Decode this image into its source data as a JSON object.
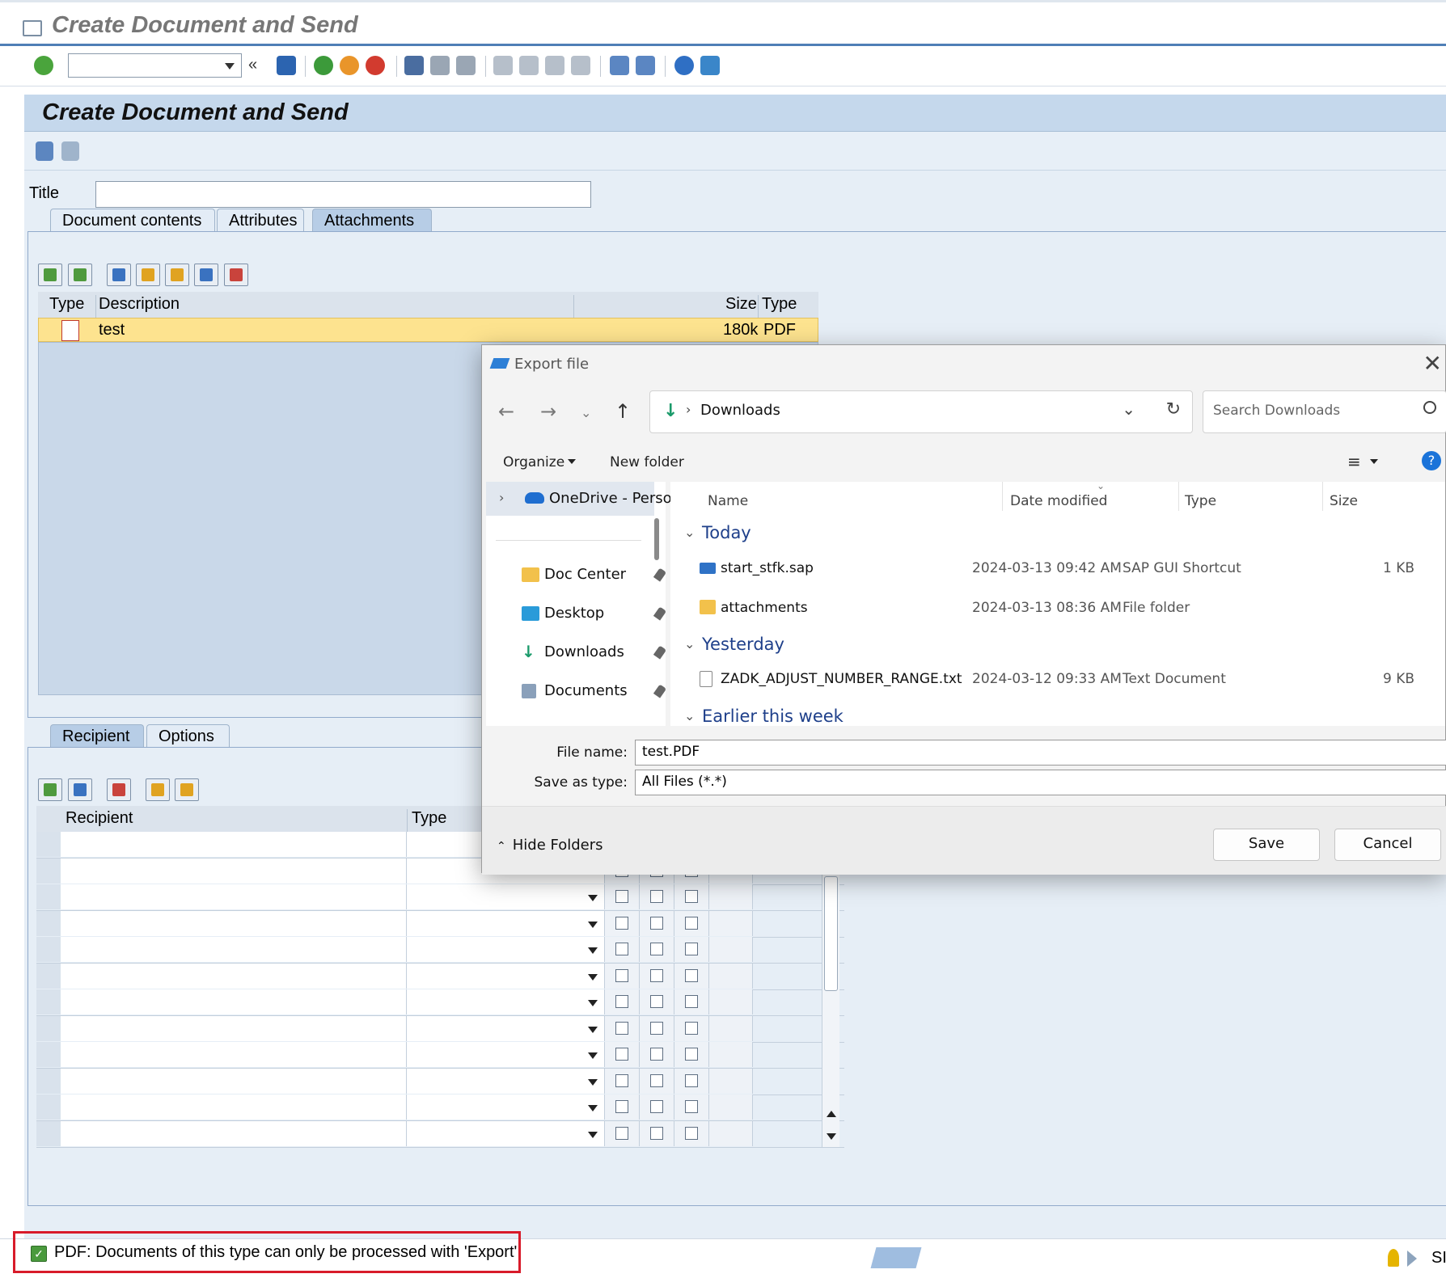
{
  "window": {
    "title": "Create Document and Send"
  },
  "page": {
    "heading": "Create Document and Send"
  },
  "fields": {
    "title_label": "Title",
    "title_value": ""
  },
  "doc_tabs": [
    {
      "label": "Document contents"
    },
    {
      "label": "Attributes"
    },
    {
      "label": "Attachments"
    }
  ],
  "active_doc_tab": "Attachments",
  "attachments": {
    "columns": [
      "Type",
      "Description",
      "Size",
      "Type"
    ],
    "rows": [
      {
        "description": "test",
        "size": "180k",
        "type": "PDF"
      }
    ]
  },
  "recipient_tabs": [
    {
      "label": "Recipient"
    },
    {
      "label": "Options"
    }
  ],
  "recipients": {
    "columns": [
      "Recipient",
      "Type"
    ]
  },
  "status": {
    "message": "PDF: Documents of this type can only be processed with 'Export'",
    "partial": "SI"
  },
  "dialog": {
    "title": "Export file",
    "address": "Downloads",
    "search_placeholder": "Search Downloads",
    "organize": "Organize",
    "new_folder": "New folder",
    "nav": {
      "onedrive": "OneDrive - Perso",
      "items": [
        "Doc Center",
        "Desktop",
        "Downloads",
        "Documents"
      ]
    },
    "columns": [
      "Name",
      "Date modified",
      "Type",
      "Size"
    ],
    "groups": [
      {
        "label": "Today",
        "files": [
          {
            "name": "start_stfk.sap",
            "date": "2024-03-13 09:42 AM",
            "type": "SAP GUI Shortcut",
            "size": "1 KB"
          },
          {
            "name": "attachments",
            "date": "2024-03-13 08:36 AM",
            "type": "File folder",
            "size": ""
          }
        ]
      },
      {
        "label": "Yesterday",
        "files": [
          {
            "name": "ZADK_ADJUST_NUMBER_RANGE.txt",
            "date": "2024-03-12 09:33 AM",
            "type": "Text Document",
            "size": "9 KB"
          }
        ]
      },
      {
        "label": "Earlier this week",
        "files": []
      }
    ],
    "file_name_label": "File name:",
    "file_name": "test.PDF",
    "save_type_label": "Save as type:",
    "save_type": "All Files (*.*)",
    "hide_folders": "Hide Folders",
    "save": "Save",
    "cancel": "Cancel"
  },
  "colors": {
    "sap_blue": "#4f7fb6",
    "selection": "#fde38f",
    "status_highlight": "#d81b2a"
  }
}
